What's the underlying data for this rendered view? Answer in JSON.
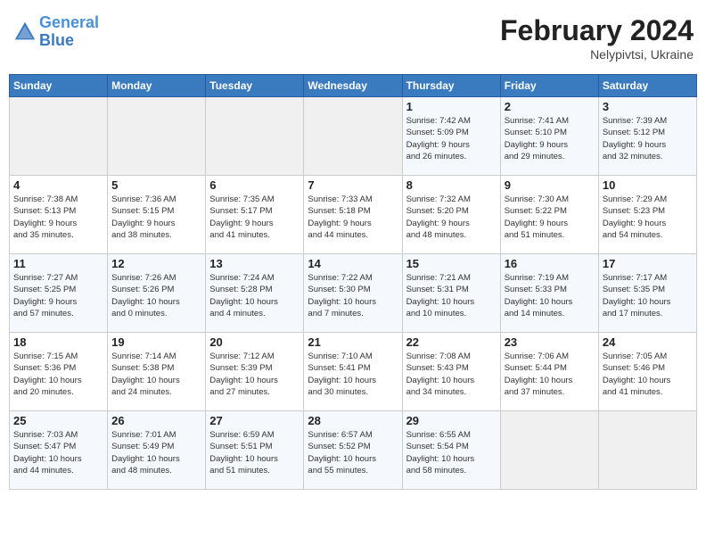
{
  "header": {
    "logo_line1": "General",
    "logo_line2": "Blue",
    "month_year": "February 2024",
    "location": "Nelypivtsi, Ukraine"
  },
  "weekdays": [
    "Sunday",
    "Monday",
    "Tuesday",
    "Wednesday",
    "Thursday",
    "Friday",
    "Saturday"
  ],
  "weeks": [
    [
      {
        "day": "",
        "info": ""
      },
      {
        "day": "",
        "info": ""
      },
      {
        "day": "",
        "info": ""
      },
      {
        "day": "",
        "info": ""
      },
      {
        "day": "1",
        "info": "Sunrise: 7:42 AM\nSunset: 5:09 PM\nDaylight: 9 hours\nand 26 minutes."
      },
      {
        "day": "2",
        "info": "Sunrise: 7:41 AM\nSunset: 5:10 PM\nDaylight: 9 hours\nand 29 minutes."
      },
      {
        "day": "3",
        "info": "Sunrise: 7:39 AM\nSunset: 5:12 PM\nDaylight: 9 hours\nand 32 minutes."
      }
    ],
    [
      {
        "day": "4",
        "info": "Sunrise: 7:38 AM\nSunset: 5:13 PM\nDaylight: 9 hours\nand 35 minutes."
      },
      {
        "day": "5",
        "info": "Sunrise: 7:36 AM\nSunset: 5:15 PM\nDaylight: 9 hours\nand 38 minutes."
      },
      {
        "day": "6",
        "info": "Sunrise: 7:35 AM\nSunset: 5:17 PM\nDaylight: 9 hours\nand 41 minutes."
      },
      {
        "day": "7",
        "info": "Sunrise: 7:33 AM\nSunset: 5:18 PM\nDaylight: 9 hours\nand 44 minutes."
      },
      {
        "day": "8",
        "info": "Sunrise: 7:32 AM\nSunset: 5:20 PM\nDaylight: 9 hours\nand 48 minutes."
      },
      {
        "day": "9",
        "info": "Sunrise: 7:30 AM\nSunset: 5:22 PM\nDaylight: 9 hours\nand 51 minutes."
      },
      {
        "day": "10",
        "info": "Sunrise: 7:29 AM\nSunset: 5:23 PM\nDaylight: 9 hours\nand 54 minutes."
      }
    ],
    [
      {
        "day": "11",
        "info": "Sunrise: 7:27 AM\nSunset: 5:25 PM\nDaylight: 9 hours\nand 57 minutes."
      },
      {
        "day": "12",
        "info": "Sunrise: 7:26 AM\nSunset: 5:26 PM\nDaylight: 10 hours\nand 0 minutes."
      },
      {
        "day": "13",
        "info": "Sunrise: 7:24 AM\nSunset: 5:28 PM\nDaylight: 10 hours\nand 4 minutes."
      },
      {
        "day": "14",
        "info": "Sunrise: 7:22 AM\nSunset: 5:30 PM\nDaylight: 10 hours\nand 7 minutes."
      },
      {
        "day": "15",
        "info": "Sunrise: 7:21 AM\nSunset: 5:31 PM\nDaylight: 10 hours\nand 10 minutes."
      },
      {
        "day": "16",
        "info": "Sunrise: 7:19 AM\nSunset: 5:33 PM\nDaylight: 10 hours\nand 14 minutes."
      },
      {
        "day": "17",
        "info": "Sunrise: 7:17 AM\nSunset: 5:35 PM\nDaylight: 10 hours\nand 17 minutes."
      }
    ],
    [
      {
        "day": "18",
        "info": "Sunrise: 7:15 AM\nSunset: 5:36 PM\nDaylight: 10 hours\nand 20 minutes."
      },
      {
        "day": "19",
        "info": "Sunrise: 7:14 AM\nSunset: 5:38 PM\nDaylight: 10 hours\nand 24 minutes."
      },
      {
        "day": "20",
        "info": "Sunrise: 7:12 AM\nSunset: 5:39 PM\nDaylight: 10 hours\nand 27 minutes."
      },
      {
        "day": "21",
        "info": "Sunrise: 7:10 AM\nSunset: 5:41 PM\nDaylight: 10 hours\nand 30 minutes."
      },
      {
        "day": "22",
        "info": "Sunrise: 7:08 AM\nSunset: 5:43 PM\nDaylight: 10 hours\nand 34 minutes."
      },
      {
        "day": "23",
        "info": "Sunrise: 7:06 AM\nSunset: 5:44 PM\nDaylight: 10 hours\nand 37 minutes."
      },
      {
        "day": "24",
        "info": "Sunrise: 7:05 AM\nSunset: 5:46 PM\nDaylight: 10 hours\nand 41 minutes."
      }
    ],
    [
      {
        "day": "25",
        "info": "Sunrise: 7:03 AM\nSunset: 5:47 PM\nDaylight: 10 hours\nand 44 minutes."
      },
      {
        "day": "26",
        "info": "Sunrise: 7:01 AM\nSunset: 5:49 PM\nDaylight: 10 hours\nand 48 minutes."
      },
      {
        "day": "27",
        "info": "Sunrise: 6:59 AM\nSunset: 5:51 PM\nDaylight: 10 hours\nand 51 minutes."
      },
      {
        "day": "28",
        "info": "Sunrise: 6:57 AM\nSunset: 5:52 PM\nDaylight: 10 hours\nand 55 minutes."
      },
      {
        "day": "29",
        "info": "Sunrise: 6:55 AM\nSunset: 5:54 PM\nDaylight: 10 hours\nand 58 minutes."
      },
      {
        "day": "",
        "info": ""
      },
      {
        "day": "",
        "info": ""
      }
    ]
  ]
}
